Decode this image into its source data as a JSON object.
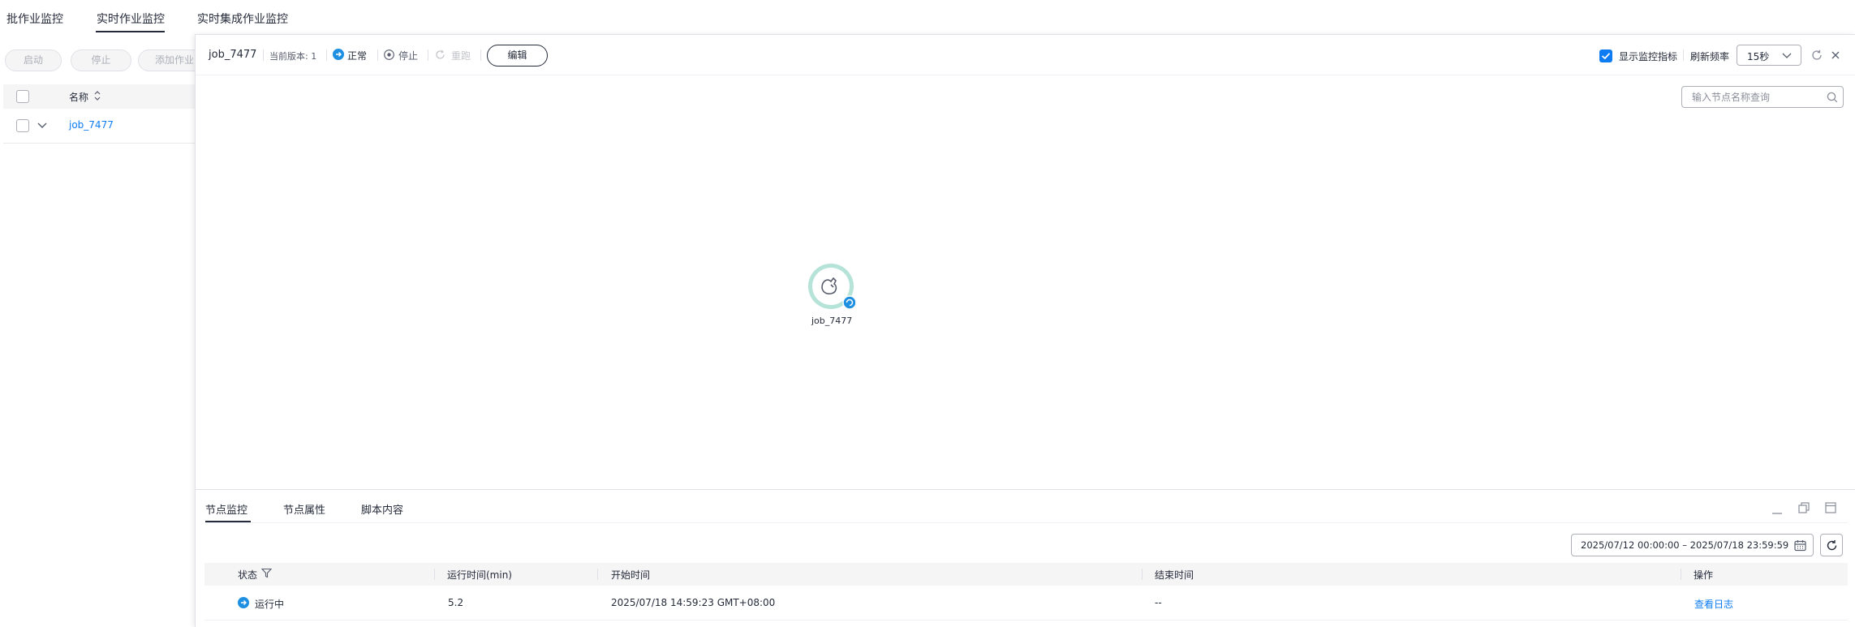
{
  "top_tabs": [
    {
      "label": "批作业监控"
    },
    {
      "label": "实时作业监控"
    },
    {
      "label": "实时集成作业监控"
    }
  ],
  "left_panel": {
    "buttons": {
      "start": "启动",
      "stop": "停止",
      "add_job": "添加作业"
    },
    "table_header": {
      "name": "名称"
    },
    "rows": [
      {
        "name": "job_7477"
      }
    ]
  },
  "toolbar": {
    "job_name": "job_7477",
    "version_label": "当前版本: 1",
    "status_label": "正常",
    "stop_label": "停止",
    "rerun_label": "重跑",
    "edit_label": "编辑",
    "show_metrics_label": "显示监控指标",
    "show_metrics_checked": true,
    "refresh_freq_label": "刷新频率",
    "refresh_freq_value": "15秒"
  },
  "canvas": {
    "search_placeholder": "输入节点名称查询",
    "node": {
      "label": "job_7477"
    }
  },
  "bottom": {
    "tabs": [
      {
        "label": "节点监控"
      },
      {
        "label": "节点属性"
      },
      {
        "label": "脚本内容"
      }
    ],
    "date_range": "2025/07/12 00:00:00 – 2025/07/18 23:59:59",
    "columns": {
      "status": "状态",
      "run_time": "运行时间(min)",
      "start_time": "开始时间",
      "end_time": "结束时间",
      "action": "操作"
    },
    "rows": [
      {
        "status": "运行中",
        "run_time": "5.2",
        "start_time": "2025/07/18 14:59:23 GMT+08:00",
        "end_time": "--",
        "action": "查看日志"
      }
    ]
  },
  "colors": {
    "accent": "#0d7cf2",
    "status_running": "#1e8fe1",
    "node_ring": "#b6e3d7"
  }
}
